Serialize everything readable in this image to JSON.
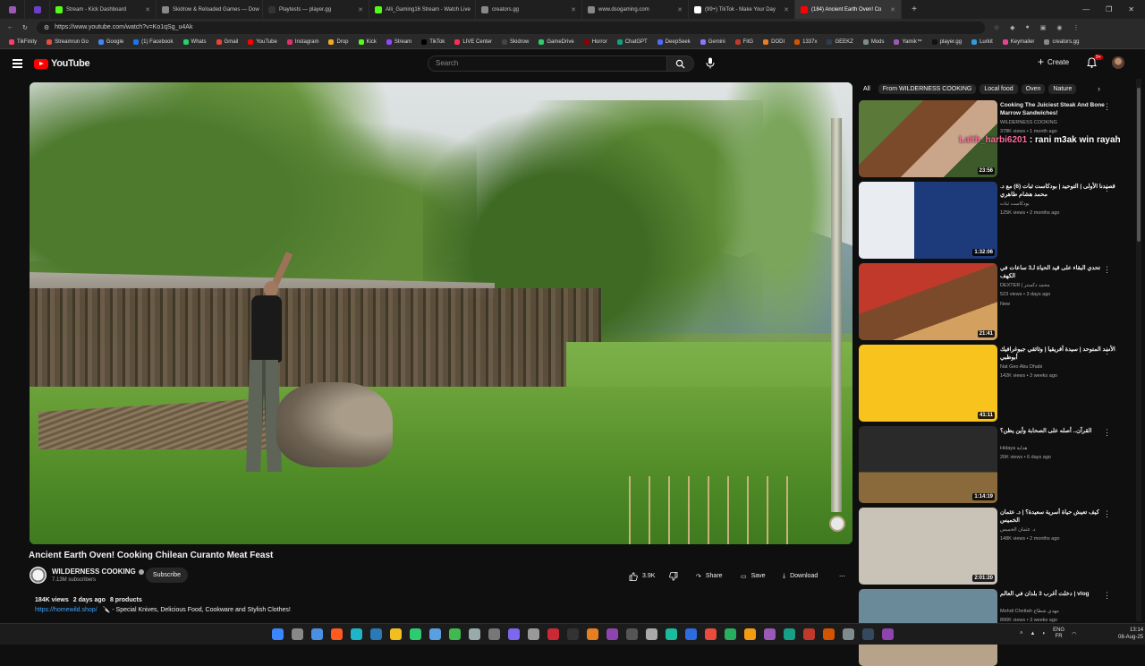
{
  "browser": {
    "tabs": [
      {
        "label": "",
        "color": "#9b59b6"
      },
      {
        "label": "",
        "color": "#6c3fc9"
      },
      {
        "label": "Stream - Kick Dashboard",
        "color": "#53fc18"
      },
      {
        "label": "Skidrow & Reloaded Games — Dow",
        "color": "#888888"
      },
      {
        "label": "Playtests — player.gg",
        "color": "#333333"
      },
      {
        "label": "Alli_Gaming16 Stream - Watch Live",
        "color": "#53fc18"
      },
      {
        "label": "creators.gg",
        "color": "#888888"
      },
      {
        "label": "www.dsogaming.com",
        "color": "#888888"
      },
      {
        "label": "(99+) TikTok - Make Your Day",
        "color": "#ffffff"
      },
      {
        "label": "(184) Ancient Earth Oven! Co",
        "color": "#ff0000"
      }
    ],
    "url": "https://www.youtube.com/watch?v=Ko1qSg_u4Ak",
    "bookmarks": [
      "TikFinity",
      "Streamrun Go",
      "Google",
      "(1) Facebook",
      "Whats",
      "Gmail",
      "YouTube",
      "Instagram",
      "Drop",
      "Kick",
      "Stream",
      "TikTok",
      "LIVE Center",
      "Skidrow",
      "GameDrive",
      "Horror",
      "ChatGPT",
      "DeepSeek",
      "Gemini",
      "FitG",
      "DODI",
      "1337x",
      "GEEKZ",
      "Mods",
      "Yamik™",
      "player.gg",
      "Lurkit",
      "Keymailer",
      "creators.gg"
    ]
  },
  "header": {
    "logo_text": "YouTube",
    "search_placeholder": "Search",
    "create_label": "Create",
    "notif_badge": "9+"
  },
  "video": {
    "title": "Ancient Earth Oven! Cooking Chilean Curanto Meat Feast",
    "channel": "WILDERNESS COOKING",
    "subscribers": "7.13M subscribers",
    "subscribe_label": "Subscribe",
    "likes": "3.9K",
    "share_label": "Share",
    "save_label": "Save",
    "download_label": "Download",
    "views": "184K views",
    "age": "2 days ago",
    "products": "8 products",
    "link": "https://homewild.shop/",
    "link_desc": "🔪 - Special Knives, Delicious Food, Cookware and Stylish Clothes!"
  },
  "chips": [
    "All",
    "From WILDERNESS COOKING",
    "Local food",
    "Oven",
    "Nature"
  ],
  "overlay": {
    "user": "Laith_harbi6201",
    "message": " : rani m3ak win rayah"
  },
  "recommendations": [
    {
      "title": "Cooking The Juiciest Steak And Bone Marrow Sandwiches!",
      "channel": "WILDERNESS COOKING",
      "meta": "378K views • 1 month ago",
      "new": "",
      "duration": "23:56"
    },
    {
      "title": "قصيدنا الأولى | التوحيد | بودكاست ثبات (6) مع د. محمد هشام طاهري",
      "channel": "بودكاست ثبات",
      "meta": "125K views • 2 months ago",
      "new": "",
      "duration": "1:32:06"
    },
    {
      "title": "تحدي البقاء على قيد الحياة لـ3 ساعات في الكهف",
      "channel": "DEXTER | محمد دكستر",
      "meta": "523 views • 3 days ago",
      "new": "New",
      "duration": "21:41"
    },
    {
      "title": "الأسد المتوحد | سيدة أفريقيا | وثائقي جيوغرافيك أبوظبي",
      "channel": "Nat Geo Abu Dhabi",
      "meta": "142K views • 3 weeks ago",
      "new": "",
      "duration": "41:11"
    },
    {
      "title": "القرآن.. أصله على الصحابة وأين يظن؟",
      "channel": "Hidaya هداية",
      "meta": "26K views • 6 days ago",
      "new": "",
      "duration": "1:14:19"
    },
    {
      "title": "كيف تعيش حياة أسرية سعيدة؟ | د. عثمان الخميس",
      "channel": "د. عثمان الخميس",
      "meta": "148K views • 2 months ago",
      "new": "",
      "duration": "2:01:20"
    },
    {
      "title": "دخلت أغرب 3 بلدان في العالم | vlog",
      "channel": "Mehdi Chettah مهدي شطاح",
      "meta": "896K views • 3 weeks ago",
      "new": "",
      "duration": ""
    }
  ],
  "system": {
    "lang": "ENG",
    "lang2": "FR",
    "time": "13:14",
    "date": "08-Aug-25"
  }
}
